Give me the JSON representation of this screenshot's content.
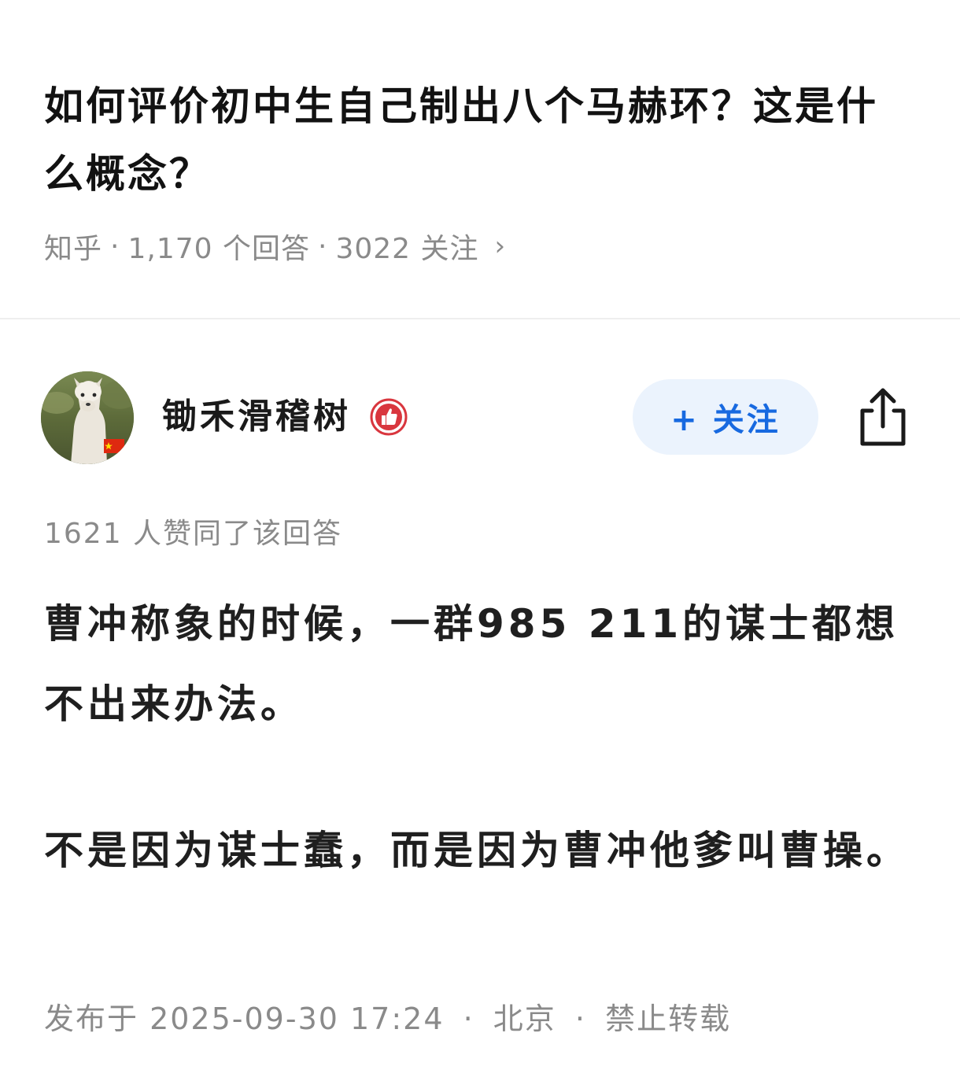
{
  "question": {
    "title": "如何评价初中生自己制出八个马赫环？这是什么概念？",
    "meta": {
      "source": "知乎",
      "separator": "·",
      "answers": "1,170 个回答",
      "followers": "3022 关注",
      "chevron": "›"
    }
  },
  "author": {
    "name": "锄禾滑稽树",
    "badge_icon": "thumbs-up-badge-icon",
    "follow_label": "+ 关注",
    "share_icon": "share-icon"
  },
  "answer": {
    "vote_text": "1621 人赞同了该回答",
    "paragraphs": [
      "曹冲称象的时候，一群985 211的谋士都想不出来办法。",
      "不是因为谋士蠢，而是因为曹冲他爹叫曹操。"
    ],
    "publish": {
      "time": "发布于 2025-09-30 17:24",
      "location": "北京",
      "copyright": "禁止转载"
    }
  },
  "colors": {
    "accent": "#1769e0",
    "follow_bg": "#ebf3fd",
    "meta_gray": "#8a8a8a",
    "badge_red": "#d9363e"
  }
}
